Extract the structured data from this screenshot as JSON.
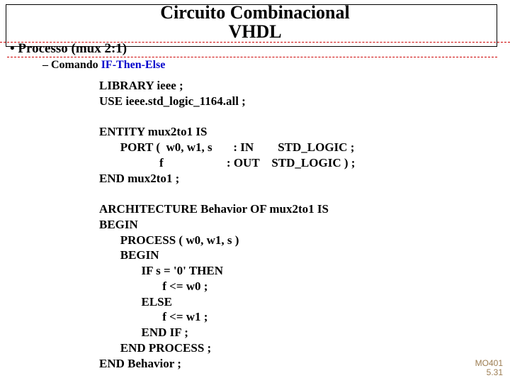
{
  "title": {
    "line1": "Circuito Combinacional",
    "line2": "VHDL"
  },
  "bullet": "• Processo  (mux 2:1)",
  "subbullet_prefix": "–  Comando ",
  "subbullet_kw": "IF-Then-Else",
  "code": "LIBRARY ieee ;\nUSE ieee.std_logic_1164.all ;\n\nENTITY mux2to1 IS\n       PORT (  w0, w1, s       : IN        STD_LOGIC ;\n                    f                     : OUT    STD_LOGIC ) ;\nEND mux2to1 ;\n\nARCHITECTURE Behavior OF mux2to1 IS\nBEGIN\n       PROCESS ( w0, w1, s )\n       BEGIN\n              IF s = '0' THEN\n                     f <= w0 ;\n              ELSE\n                     f <= w1 ;\n              END IF ;\n       END PROCESS ;\nEND Behavior ;",
  "footer": {
    "l1": "MO401",
    "l2": "5.31"
  }
}
